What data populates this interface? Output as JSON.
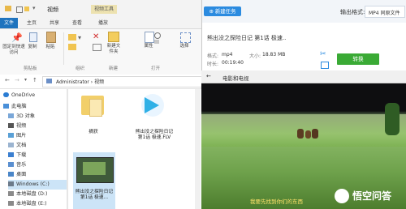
{
  "explorer": {
    "title": "视频",
    "context_tab": "视频工具",
    "tabs": [
      "文件",
      "主页",
      "共享",
      "查看",
      "播放"
    ],
    "ribbon_buttons": [
      "固定到快速访问",
      "复制",
      "粘贴",
      "移动到",
      "复制到",
      "删除",
      "重命名",
      "新建文件夹",
      "属性",
      "选择"
    ],
    "ribbon_groups": [
      "剪贴板",
      "组织",
      "新建",
      "打开"
    ],
    "address": "Administrator › 视频",
    "nav": [
      "OneDrive",
      "此电脑",
      "3D 对象",
      "视频",
      "图片",
      "文档",
      "下载",
      "音乐",
      "桌面",
      "Windows (C:)",
      "本地磁盘 (D:)",
      "本地磁盘 (E:)"
    ],
    "files": [
      {
        "name": "摘获"
      },
      {
        "name": "熊出没之探险日记 第1话 极速.FLV"
      },
      {
        "name": "熊出没之探险日记 第1话 极速..."
      }
    ]
  },
  "app": {
    "new_task": "新建任务",
    "output_format_label": "输出格式:",
    "output_format_value": "MP4 同原文件",
    "file_title": "熊出没之探险日记 第1话 极速..",
    "format_label": "格式:",
    "format_value": "mp4",
    "duration_label": "时长:",
    "duration_value": "00:19:40",
    "size_label": "大小:",
    "size_value": "18.83 MB",
    "convert": "转换"
  },
  "player": {
    "title": "电影和电视",
    "subtitle": "我要先找到你们的东西",
    "watermark": "悟空问答"
  }
}
